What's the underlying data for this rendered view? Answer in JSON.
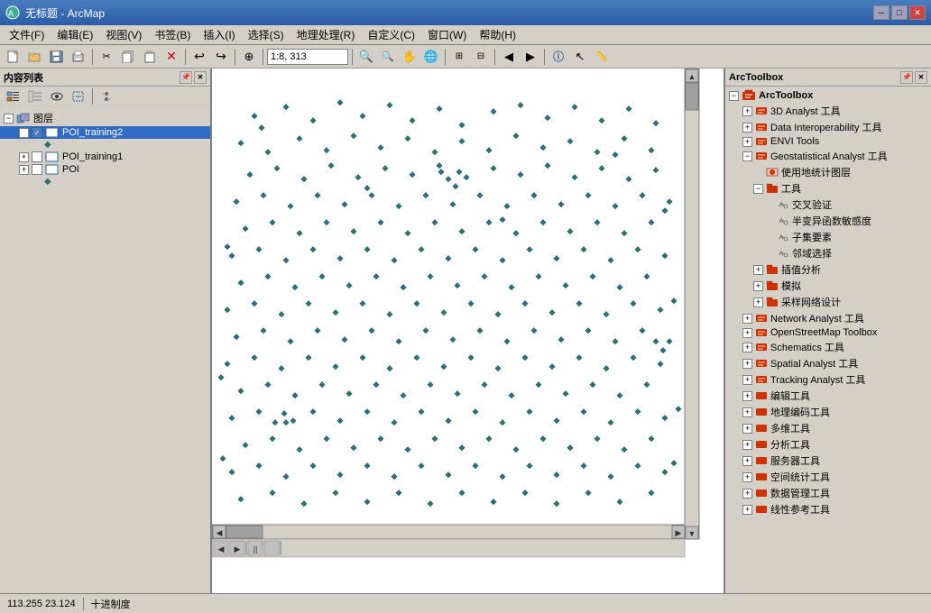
{
  "titlebar": {
    "title": "无标题 - ArcMap",
    "minimize": "─",
    "maximize": "□",
    "close": "✕"
  },
  "menu": {
    "items": [
      "文件(F)",
      "编辑(E)",
      "视图(V)",
      "书签(B)",
      "插入(I)",
      "选择(S)",
      "地理处理(R)",
      "自定义(C)",
      "窗口(W)",
      "帮助(H)"
    ]
  },
  "toolbar": {
    "scale": "1:8, 313"
  },
  "toc": {
    "title": "内容列表",
    "layers": [
      {
        "name": "图层",
        "level": 0,
        "type": "group",
        "expanded": true
      },
      {
        "name": "POI_training2",
        "level": 1,
        "type": "layer",
        "checked": true,
        "selected": true
      },
      {
        "name": "POI_training1",
        "level": 1,
        "type": "layer",
        "checked": false
      },
      {
        "name": "POI",
        "level": 1,
        "type": "layer",
        "checked": false
      }
    ]
  },
  "toolbox": {
    "title": "ArcToolbox",
    "items": [
      {
        "label": "ArcToolbox",
        "level": 0,
        "type": "root",
        "icon": "toolbox"
      },
      {
        "label": "3D Analyst 工具",
        "level": 1,
        "type": "folder",
        "expanded": false
      },
      {
        "label": "Data Interoperability 工具",
        "level": 1,
        "type": "folder",
        "expanded": false
      },
      {
        "label": "ENVI Tools",
        "level": 1,
        "type": "folder",
        "expanded": false
      },
      {
        "label": "Geostatistical Analyst 工具",
        "level": 1,
        "type": "folder",
        "expanded": true
      },
      {
        "label": "使用地统计图层",
        "level": 2,
        "type": "tool"
      },
      {
        "label": "工具",
        "level": 2,
        "type": "folder",
        "expanded": true
      },
      {
        "label": "交叉验证",
        "level": 3,
        "type": "tool"
      },
      {
        "label": "半变异函数敏感度",
        "level": 3,
        "type": "tool"
      },
      {
        "label": "子集要素",
        "level": 3,
        "type": "tool"
      },
      {
        "label": "邻域选择",
        "level": 3,
        "type": "tool"
      },
      {
        "label": "插值分析",
        "level": 2,
        "type": "folder",
        "expanded": false
      },
      {
        "label": "模拟",
        "level": 2,
        "type": "folder",
        "expanded": false
      },
      {
        "label": "采样网络设计",
        "level": 2,
        "type": "folder",
        "expanded": false
      },
      {
        "label": "Network Analyst 工具",
        "level": 1,
        "type": "folder",
        "expanded": false
      },
      {
        "label": "OpenStreetMap Toolbox",
        "level": 1,
        "type": "folder",
        "expanded": false
      },
      {
        "label": "Schematics 工具",
        "level": 1,
        "type": "folder",
        "expanded": false
      },
      {
        "label": "Spatial Analyst 工具",
        "level": 1,
        "type": "folder",
        "expanded": false
      },
      {
        "label": "Tracking Analyst 工具",
        "level": 1,
        "type": "folder",
        "expanded": false
      },
      {
        "label": "编辑工具",
        "level": 1,
        "type": "folder",
        "expanded": false
      },
      {
        "label": "地理编码工具",
        "level": 1,
        "type": "folder",
        "expanded": false
      },
      {
        "label": "多维工具",
        "level": 1,
        "type": "folder",
        "expanded": false
      },
      {
        "label": "分析工具",
        "level": 1,
        "type": "folder",
        "expanded": false
      },
      {
        "label": "服务器工具",
        "level": 1,
        "type": "folder",
        "expanded": false
      },
      {
        "label": "空间统计工具",
        "level": 1,
        "type": "folder",
        "expanded": false
      },
      {
        "label": "数据管理工具",
        "level": 1,
        "type": "folder",
        "expanded": false
      },
      {
        "label": "线性参考工具",
        "level": 1,
        "type": "folder",
        "expanded": false
      }
    ]
  },
  "statusbar": {
    "coords": "113.255  23.124",
    "units": "十进制度"
  }
}
